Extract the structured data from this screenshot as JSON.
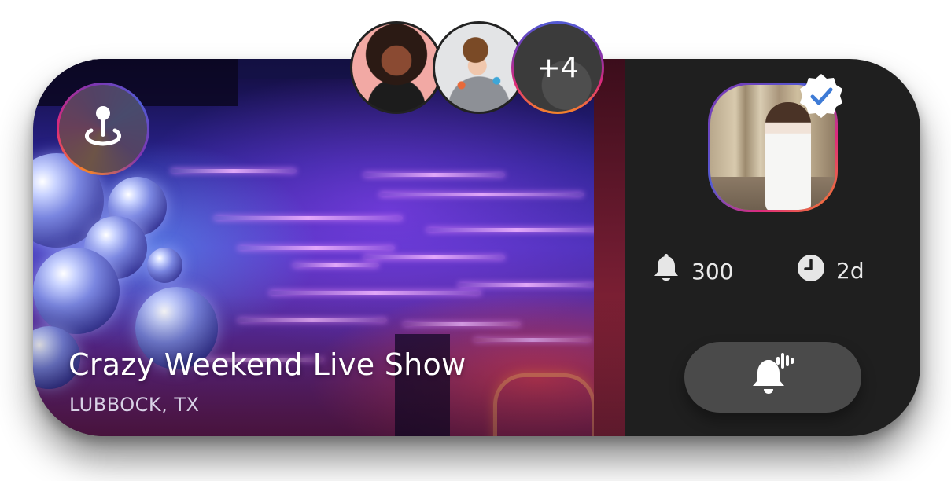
{
  "event": {
    "title": "Crazy Weekend Live Show",
    "location": "LUBBOCK, TX"
  },
  "attendees": {
    "extra_count_label": "+4"
  },
  "stats": {
    "subscribers": "300",
    "time_left": "2d"
  },
  "icons": {
    "location": "map-pin-icon",
    "verified": "verified-badge-icon",
    "bell": "bell-icon",
    "clock": "clock-icon",
    "notify": "bell-ringing-icon"
  },
  "colors": {
    "card_background": "#1f1f1f",
    "button_background": "#4a4a4a",
    "gradient_start": "#f58529",
    "gradient_mid": "#dd2a7b",
    "gradient_end": "#515bd4"
  }
}
